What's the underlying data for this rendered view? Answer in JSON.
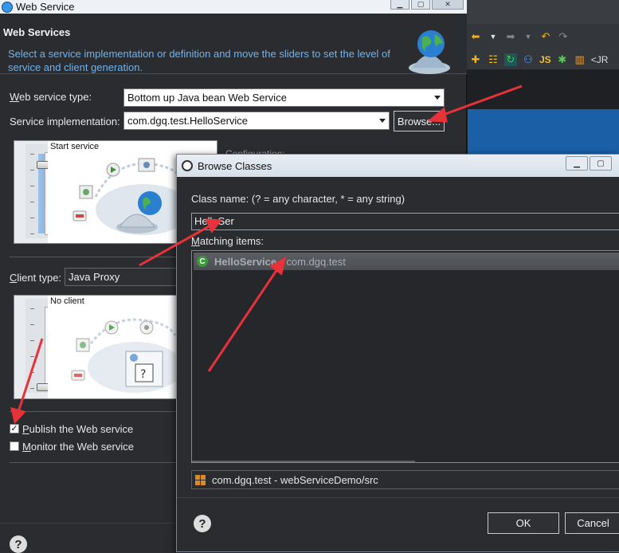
{
  "ws_dialog": {
    "title": "Web Service",
    "header_title": "Web Services",
    "header_desc": "Select a service implementation or definition and move the sliders to set the level of service and client generation.",
    "service_type_label_prefix": "W",
    "service_type_label_rest": "eb service type:",
    "service_type_value": "Bottom up Java bean Web Service",
    "service_impl_label": "Service implementation:",
    "service_impl_value": "com.dgq.test.HelloService",
    "browse_label": "Browse...",
    "service_slider_label": "Start service",
    "config_label": "Configuration:",
    "client_type_label_prefix": "C",
    "client_type_label_rest": "lient type:",
    "client_type_value": "Java Proxy",
    "client_slider_label": "No client",
    "publish_label_prefix": "P",
    "publish_label_rest": "ublish the Web service",
    "publish_checked": "✓",
    "monitor_label_prefix": "M",
    "monitor_label_rest": "onitor the Web service",
    "help_icon": "?"
  },
  "browse_dialog": {
    "title": "Browse Classes",
    "class_name_label": "Class name: (? = any character, * = any string)",
    "class_name_value": "HelloSer",
    "matching_label_prefix": "M",
    "matching_label_rest": "atching items:",
    "items": [
      {
        "name": "HelloService",
        "separator": "-",
        "package": "com.dgq.test",
        "icon": "C"
      }
    ],
    "status_text": "com.dgq.test - webServiceDemo/src",
    "ok_label": "OK",
    "cancel_label": "Cancel",
    "help_icon": "?"
  },
  "ide": {
    "toolbar_text": "<JR",
    "js_label": "JS"
  },
  "colors": {
    "annotation_arrow": "#e8323a",
    "header_desc": "#6fb3ee",
    "ide_blue": "#1b5fa6"
  }
}
